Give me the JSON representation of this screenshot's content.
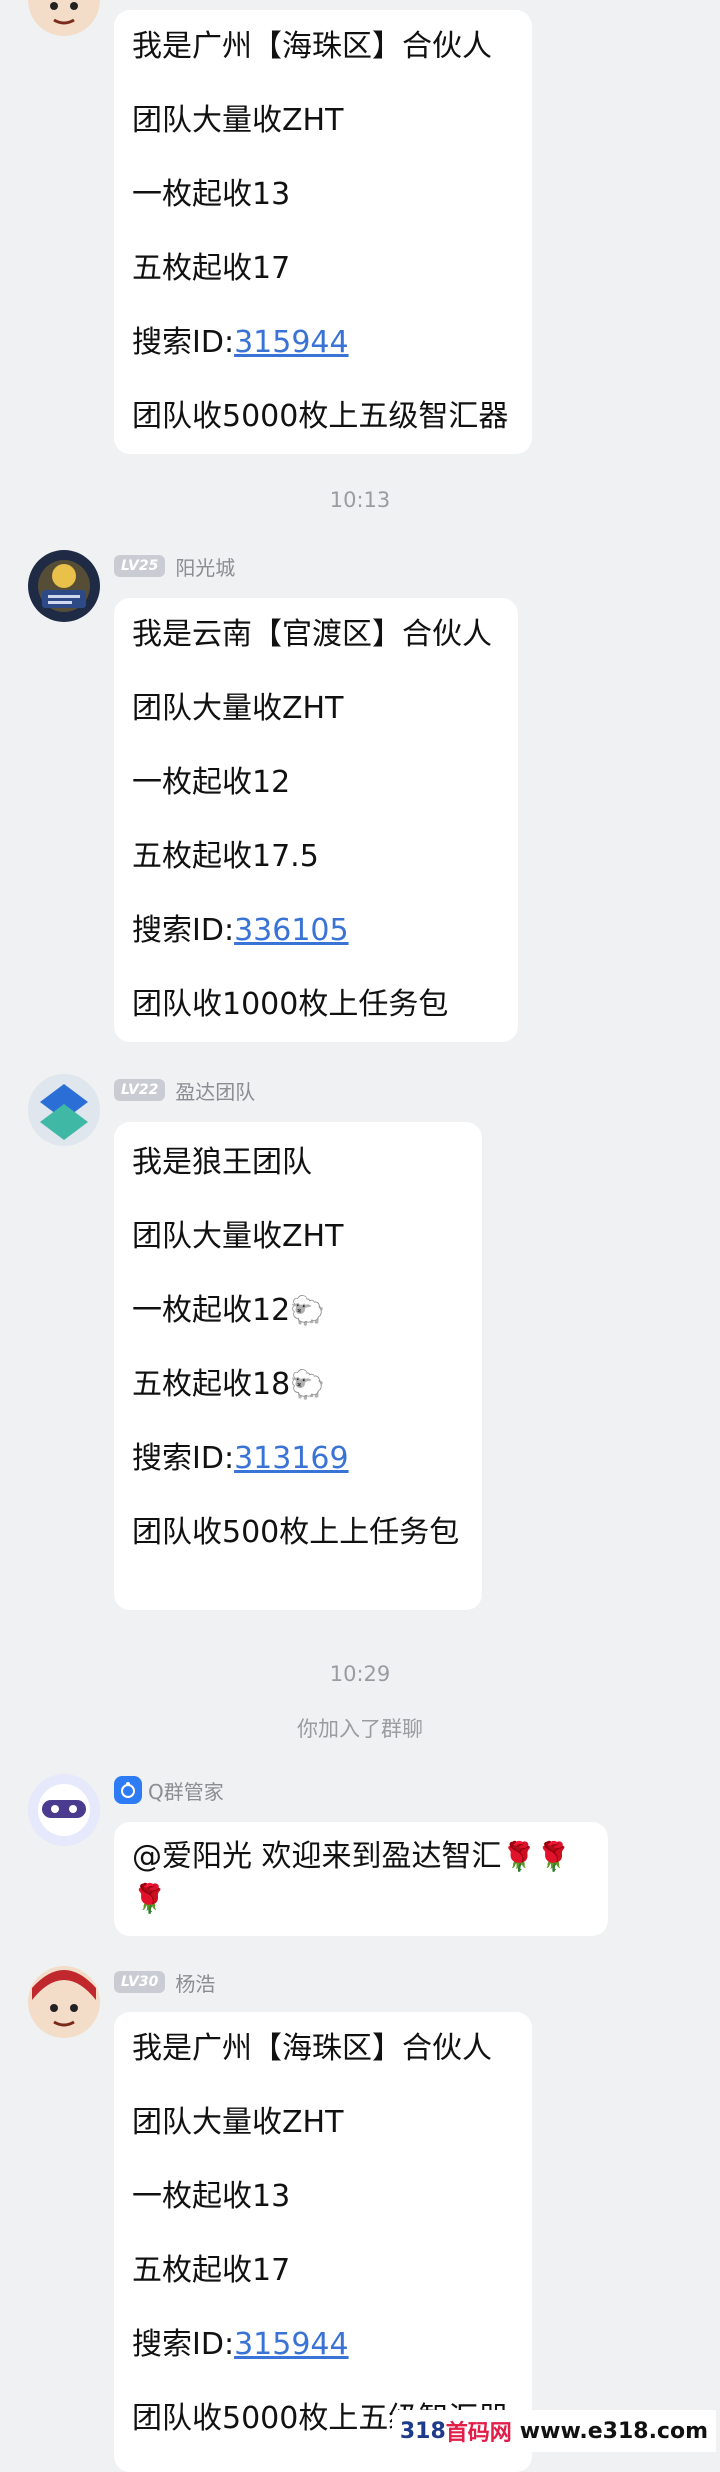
{
  "messages": [
    {
      "lines": [
        {
          "text": "我是广州【海珠区】合伙人"
        },
        {
          "text": "团队大量收ZHT"
        },
        {
          "text": "一枚起收13"
        },
        {
          "text": "五枚起收17"
        },
        {
          "prefix": "搜索ID:",
          "link": "315944"
        },
        {
          "text": "团队收5000枚上五级智汇器"
        }
      ]
    },
    {
      "level": "LV25",
      "name": "阳光城",
      "lines": [
        {
          "text": "我是云南【官渡区】合伙人"
        },
        {
          "text": "团队大量收ZHT"
        },
        {
          "text": "一枚起收12"
        },
        {
          "text": "五枚起收17.5"
        },
        {
          "prefix": "搜索ID:",
          "link": "336105"
        },
        {
          "text": "团队收1000枚上任务包"
        }
      ]
    },
    {
      "level": "LV22",
      "name": "盈达团队",
      "lines": [
        {
          "text": "我是狼王团队"
        },
        {
          "text": "团队大量收ZHT"
        },
        {
          "text": "一枚起收12",
          "emoji": "🐑"
        },
        {
          "text": "五枚起收18",
          "emoji": "🐑"
        },
        {
          "prefix": "搜索ID:",
          "link": "313169"
        },
        {
          "text": "团队收500枚上上任务包"
        }
      ]
    },
    {
      "name": "Q群管家",
      "lines": [
        {
          "text": "@爱阳光 欢迎来到盈达智汇",
          "emoji": "🌹🌹",
          "line2_emoji": "🌹"
        }
      ]
    },
    {
      "level": "LV30",
      "name": "杨浩",
      "lines": [
        {
          "text": "我是广州【海珠区】合伙人"
        },
        {
          "text": "团队大量收ZHT"
        },
        {
          "text": "一枚起收13"
        },
        {
          "text": "五枚起收17"
        },
        {
          "prefix": "搜索ID:",
          "link": "315944"
        },
        {
          "text": "团队收5000枚上五级智汇器"
        }
      ]
    }
  ],
  "timestamps": [
    "10:13",
    "10:29"
  ],
  "system_notice": "你加入了群聊",
  "watermark": {
    "part1": "318",
    "part2": "首码网",
    "site": "www.e318.com"
  },
  "colors": {
    "background": "#f0f1f3",
    "bubble": "#ffffff",
    "link": "#3a73d6",
    "level_badge": "#c9ccd3"
  }
}
